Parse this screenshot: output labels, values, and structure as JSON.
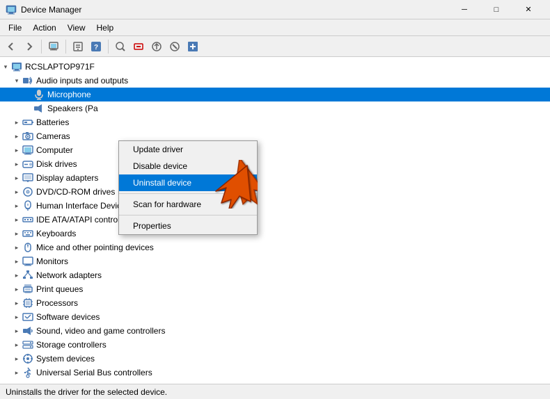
{
  "titleBar": {
    "icon": "computer-icon",
    "title": "Device Manager",
    "buttons": {
      "minimize": "─",
      "maximize": "□",
      "close": "✕"
    }
  },
  "menuBar": {
    "items": [
      "File",
      "Action",
      "View",
      "Help"
    ]
  },
  "toolbar": {
    "buttons": [
      "back",
      "forward",
      "up",
      "properties",
      "help",
      "scan",
      "uninstall",
      "update",
      "rollback",
      "disable",
      "enable",
      "add"
    ]
  },
  "tree": {
    "root": "RCSLAPTOP971F",
    "items": [
      {
        "id": "audio",
        "label": "Audio inputs and outputs",
        "level": 1,
        "expanded": true,
        "icon": "audio"
      },
      {
        "id": "microphone",
        "label": "Microphone",
        "level": 2,
        "selected": true,
        "icon": "mic"
      },
      {
        "id": "speakers",
        "label": "Speakers (Pa",
        "level": 2,
        "icon": "speaker"
      },
      {
        "id": "batteries",
        "label": "Batteries",
        "level": 1,
        "icon": "battery"
      },
      {
        "id": "cameras",
        "label": "Cameras",
        "level": 1,
        "icon": "camera"
      },
      {
        "id": "computer",
        "label": "Computer",
        "level": 1,
        "icon": "monitor"
      },
      {
        "id": "diskdrives",
        "label": "Disk drives",
        "level": 1,
        "icon": "disk"
      },
      {
        "id": "displayadapters",
        "label": "Display adapters",
        "level": 1,
        "icon": "display"
      },
      {
        "id": "dvdrom",
        "label": "DVD/CD-ROM drives",
        "level": 1,
        "icon": "dvd"
      },
      {
        "id": "hid",
        "label": "Human Interface Devices",
        "level": 1,
        "icon": "hid"
      },
      {
        "id": "ide",
        "label": "IDE ATA/ATAPI controllers",
        "level": 1,
        "icon": "ide"
      },
      {
        "id": "keyboards",
        "label": "Keyboards",
        "level": 1,
        "icon": "keyboard"
      },
      {
        "id": "mice",
        "label": "Mice and other pointing devices",
        "level": 1,
        "icon": "mouse"
      },
      {
        "id": "monitors",
        "label": "Monitors",
        "level": 1,
        "icon": "monitor"
      },
      {
        "id": "networkadapters",
        "label": "Network adapters",
        "level": 1,
        "icon": "network"
      },
      {
        "id": "printqueues",
        "label": "Print queues",
        "level": 1,
        "icon": "print"
      },
      {
        "id": "processors",
        "label": "Processors",
        "level": 1,
        "icon": "processor"
      },
      {
        "id": "softwaredevices",
        "label": "Software devices",
        "level": 1,
        "icon": "software"
      },
      {
        "id": "sound",
        "label": "Sound, video and game controllers",
        "level": 1,
        "icon": "sound"
      },
      {
        "id": "storagecontrollers",
        "label": "Storage controllers",
        "level": 1,
        "icon": "storage"
      },
      {
        "id": "systemdevices",
        "label": "System devices",
        "level": 1,
        "icon": "system"
      },
      {
        "id": "usb",
        "label": "Universal Serial Bus controllers",
        "level": 1,
        "icon": "usb"
      }
    ]
  },
  "contextMenu": {
    "items": [
      {
        "id": "update-driver",
        "label": "Update driver"
      },
      {
        "id": "disable-device",
        "label": "Disable device"
      },
      {
        "id": "uninstall-device",
        "label": "Uninstall device",
        "highlighted": true
      },
      {
        "id": "separator1",
        "type": "separator"
      },
      {
        "id": "scan-hardware",
        "label": "Scan for hardware"
      },
      {
        "id": "separator2",
        "type": "separator"
      },
      {
        "id": "properties",
        "label": "Properties"
      }
    ]
  },
  "statusBar": {
    "text": "Uninstalls the driver for the selected device."
  }
}
